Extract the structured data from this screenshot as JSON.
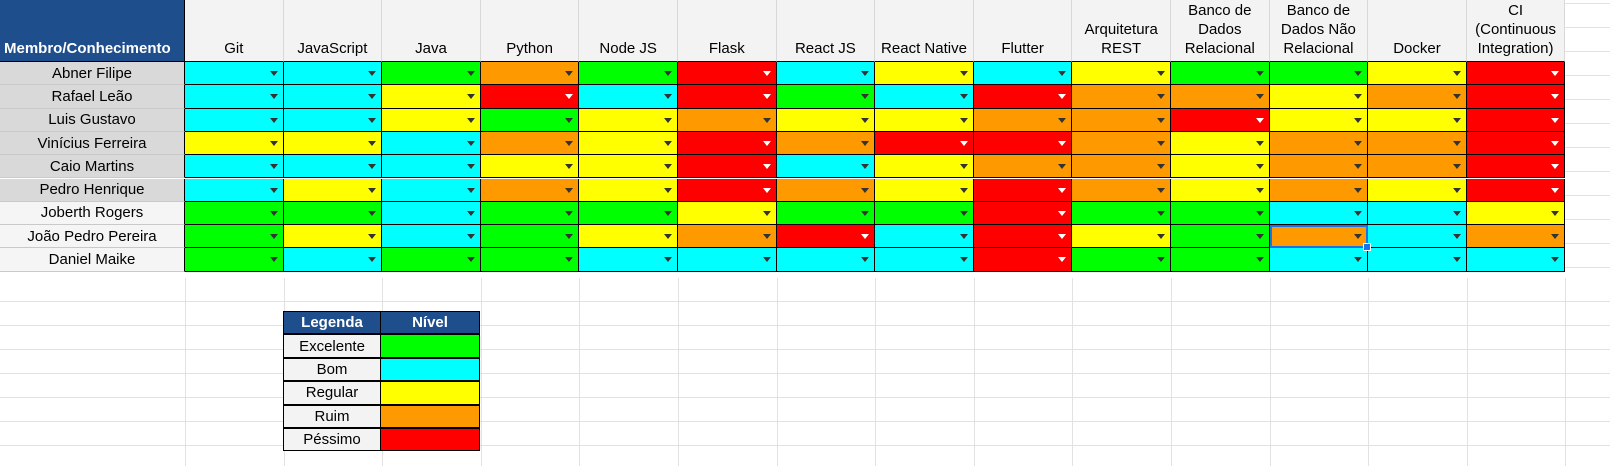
{
  "header": {
    "first": "Membro/Conhecimento",
    "columns": [
      "Git",
      "JavaScript",
      "Java",
      "Python",
      "Node JS",
      "Flask",
      "React JS",
      "React Native",
      "Flutter",
      "Arquitetura REST",
      "Banco de Dados Relacional",
      "Banco de Dados Não Relacional",
      "Docker",
      "CI (Continuous Integration)"
    ]
  },
  "colors": {
    "G": "#00ff00",
    "C": "#00ffff",
    "Y": "#ffff00",
    "O": "#ff9900",
    "R": "#ff0000",
    "header_bg": "#1f4e8c"
  },
  "members": [
    {
      "name": "Abner Filipe",
      "shade": "gray",
      "levels": [
        "C",
        "C",
        "G",
        "O",
        "G",
        "R",
        "C",
        "Y",
        "C",
        "Y",
        "G",
        "G",
        "Y",
        "R"
      ]
    },
    {
      "name": "Rafael Leão",
      "shade": "gray",
      "levels": [
        "C",
        "C",
        "Y",
        "R",
        "C",
        "R",
        "G",
        "C",
        "R",
        "O",
        "O",
        "Y",
        "O",
        "R"
      ]
    },
    {
      "name": "Luis Gustavo",
      "shade": "gray",
      "levels": [
        "C",
        "C",
        "Y",
        "G",
        "Y",
        "O",
        "Y",
        "Y",
        "O",
        "O",
        "R",
        "Y",
        "Y",
        "R"
      ]
    },
    {
      "name": "Vinícius Ferreira",
      "shade": "gray",
      "levels": [
        "Y",
        "Y",
        "C",
        "O",
        "Y",
        "R",
        "O",
        "R",
        "R",
        "O",
        "Y",
        "O",
        "O",
        "R"
      ]
    },
    {
      "name": "Caio Martins",
      "shade": "gray",
      "levels": [
        "C",
        "C",
        "C",
        "Y",
        "Y",
        "R",
        "C",
        "Y",
        "O",
        "O",
        "Y",
        "O",
        "O",
        "R"
      ]
    },
    {
      "name": "Pedro Henrique",
      "shade": "gray",
      "levels": [
        "C",
        "Y",
        "C",
        "O",
        "Y",
        "R",
        "O",
        "Y",
        "R",
        "O",
        "Y",
        "O",
        "Y",
        "R"
      ]
    },
    {
      "name": "Joberth Rogers",
      "shade": "white",
      "levels": [
        "G",
        "G",
        "C",
        "G",
        "G",
        "Y",
        "G",
        "G",
        "R",
        "G",
        "G",
        "C",
        "C",
        "Y"
      ]
    },
    {
      "name": "João Pedro Pereira",
      "shade": "white",
      "levels": [
        "G",
        "Y",
        "C",
        "G",
        "Y",
        "O",
        "R",
        "C",
        "R",
        "Y",
        "G",
        "O",
        "C",
        "O"
      ]
    },
    {
      "name": "Daniel Maike",
      "shade": "white",
      "levels": [
        "G",
        "C",
        "G",
        "G",
        "C",
        "C",
        "C",
        "C",
        "R",
        "G",
        "G",
        "C",
        "C",
        "C"
      ]
    }
  ],
  "legend": {
    "title": "Legenda",
    "level_header": "Nível",
    "items": [
      {
        "label": "Excelente",
        "color": "#00ff00"
      },
      {
        "label": "Bom",
        "color": "#00ffff"
      },
      {
        "label": "Regular",
        "color": "#ffff00"
      },
      {
        "label": "Ruim",
        "color": "#ff9900"
      },
      {
        "label": "Péssimo",
        "color": "#ff0000"
      }
    ]
  }
}
